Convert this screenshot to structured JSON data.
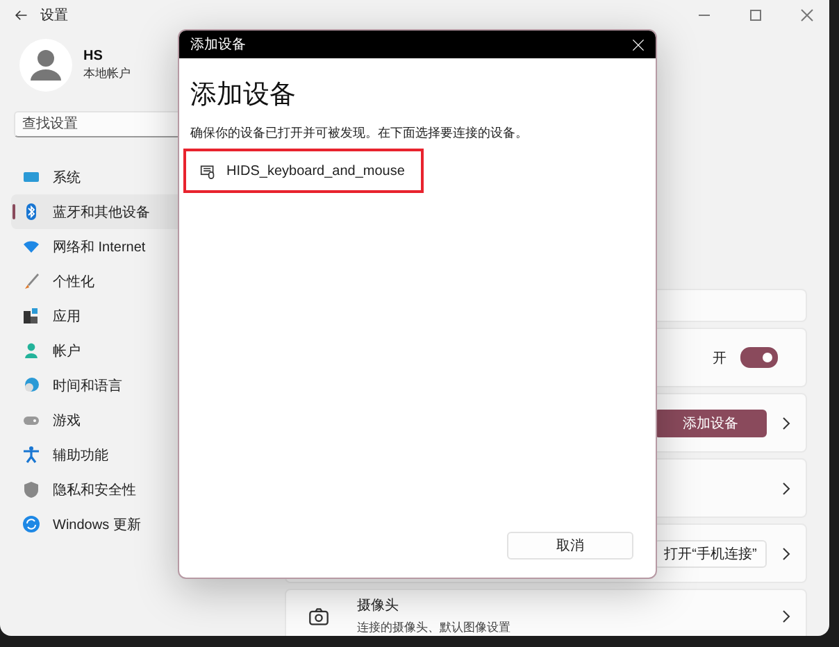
{
  "window": {
    "title": "设置"
  },
  "profile": {
    "name": "HS",
    "account_type": "本地帐户"
  },
  "search": {
    "placeholder": "查找设置"
  },
  "nav": [
    {
      "label": "系统",
      "selected": false
    },
    {
      "label": "蓝牙和其他设备",
      "selected": true
    },
    {
      "label": "网络和 Internet",
      "selected": false
    },
    {
      "label": "个性化",
      "selected": false
    },
    {
      "label": "应用",
      "selected": false
    },
    {
      "label": "帐户",
      "selected": false
    },
    {
      "label": "时间和语言",
      "selected": false
    },
    {
      "label": "游戏",
      "selected": false
    },
    {
      "label": "辅助功能",
      "selected": false
    },
    {
      "label": "隐私和安全性",
      "selected": false
    },
    {
      "label": "Windows 更新",
      "selected": false
    }
  ],
  "cards": [
    {
      "kind": "blank"
    },
    {
      "kind": "toggle",
      "state_label": "开",
      "on": true
    },
    {
      "kind": "button",
      "button": "添加设备",
      "primary": true
    },
    {
      "kind": "link"
    },
    {
      "kind": "button",
      "button": "打开“手机连接”",
      "primary": false
    },
    {
      "kind": "device",
      "title": "摄像头",
      "subtitle": "连接的摄像头、默认图像设置"
    }
  ],
  "dialog": {
    "title": "添加设备",
    "heading": "添加设备",
    "description": "确保你的设备已打开并可被发现。在下面选择要连接的设备。",
    "devices": [
      {
        "name": "HIDS_keyboard_and_mouse",
        "selected": true
      }
    ],
    "buttons": [
      "取消"
    ]
  }
}
